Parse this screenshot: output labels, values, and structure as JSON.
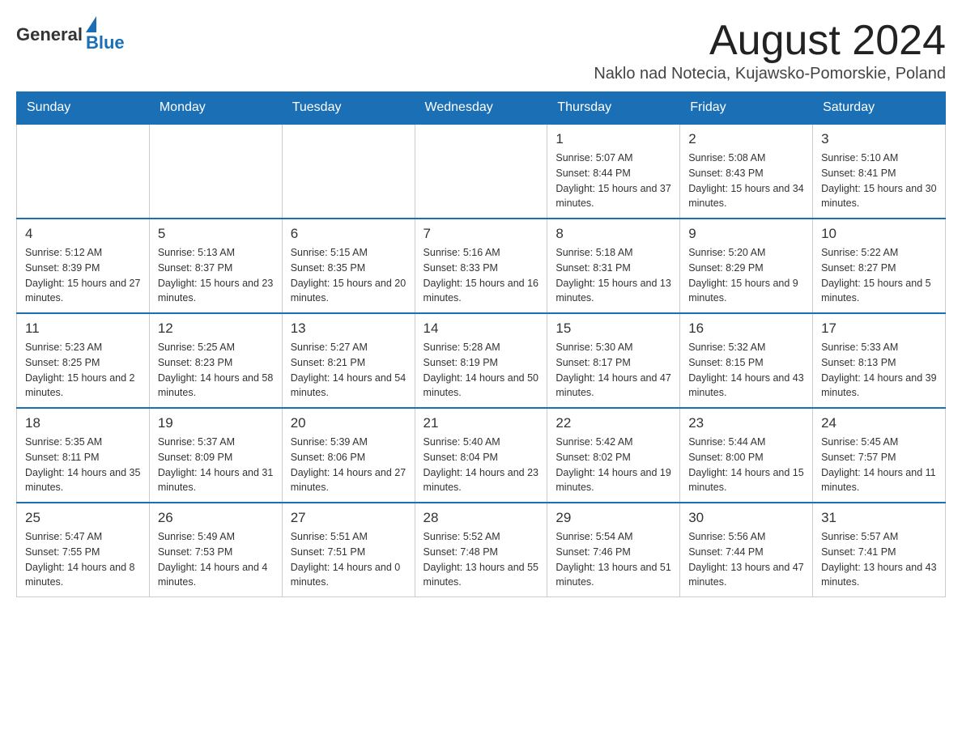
{
  "header": {
    "logo_general": "General",
    "logo_blue": "Blue",
    "title": "August 2024",
    "location": "Naklo nad Notecia, Kujawsko-Pomorskie, Poland"
  },
  "weekdays": [
    "Sunday",
    "Monday",
    "Tuesday",
    "Wednesday",
    "Thursday",
    "Friday",
    "Saturday"
  ],
  "weeks": [
    [
      {
        "day": "",
        "info": ""
      },
      {
        "day": "",
        "info": ""
      },
      {
        "day": "",
        "info": ""
      },
      {
        "day": "",
        "info": ""
      },
      {
        "day": "1",
        "info": "Sunrise: 5:07 AM\nSunset: 8:44 PM\nDaylight: 15 hours and 37 minutes."
      },
      {
        "day": "2",
        "info": "Sunrise: 5:08 AM\nSunset: 8:43 PM\nDaylight: 15 hours and 34 minutes."
      },
      {
        "day": "3",
        "info": "Sunrise: 5:10 AM\nSunset: 8:41 PM\nDaylight: 15 hours and 30 minutes."
      }
    ],
    [
      {
        "day": "4",
        "info": "Sunrise: 5:12 AM\nSunset: 8:39 PM\nDaylight: 15 hours and 27 minutes."
      },
      {
        "day": "5",
        "info": "Sunrise: 5:13 AM\nSunset: 8:37 PM\nDaylight: 15 hours and 23 minutes."
      },
      {
        "day": "6",
        "info": "Sunrise: 5:15 AM\nSunset: 8:35 PM\nDaylight: 15 hours and 20 minutes."
      },
      {
        "day": "7",
        "info": "Sunrise: 5:16 AM\nSunset: 8:33 PM\nDaylight: 15 hours and 16 minutes."
      },
      {
        "day": "8",
        "info": "Sunrise: 5:18 AM\nSunset: 8:31 PM\nDaylight: 15 hours and 13 minutes."
      },
      {
        "day": "9",
        "info": "Sunrise: 5:20 AM\nSunset: 8:29 PM\nDaylight: 15 hours and 9 minutes."
      },
      {
        "day": "10",
        "info": "Sunrise: 5:22 AM\nSunset: 8:27 PM\nDaylight: 15 hours and 5 minutes."
      }
    ],
    [
      {
        "day": "11",
        "info": "Sunrise: 5:23 AM\nSunset: 8:25 PM\nDaylight: 15 hours and 2 minutes."
      },
      {
        "day": "12",
        "info": "Sunrise: 5:25 AM\nSunset: 8:23 PM\nDaylight: 14 hours and 58 minutes."
      },
      {
        "day": "13",
        "info": "Sunrise: 5:27 AM\nSunset: 8:21 PM\nDaylight: 14 hours and 54 minutes."
      },
      {
        "day": "14",
        "info": "Sunrise: 5:28 AM\nSunset: 8:19 PM\nDaylight: 14 hours and 50 minutes."
      },
      {
        "day": "15",
        "info": "Sunrise: 5:30 AM\nSunset: 8:17 PM\nDaylight: 14 hours and 47 minutes."
      },
      {
        "day": "16",
        "info": "Sunrise: 5:32 AM\nSunset: 8:15 PM\nDaylight: 14 hours and 43 minutes."
      },
      {
        "day": "17",
        "info": "Sunrise: 5:33 AM\nSunset: 8:13 PM\nDaylight: 14 hours and 39 minutes."
      }
    ],
    [
      {
        "day": "18",
        "info": "Sunrise: 5:35 AM\nSunset: 8:11 PM\nDaylight: 14 hours and 35 minutes."
      },
      {
        "day": "19",
        "info": "Sunrise: 5:37 AM\nSunset: 8:09 PM\nDaylight: 14 hours and 31 minutes."
      },
      {
        "day": "20",
        "info": "Sunrise: 5:39 AM\nSunset: 8:06 PM\nDaylight: 14 hours and 27 minutes."
      },
      {
        "day": "21",
        "info": "Sunrise: 5:40 AM\nSunset: 8:04 PM\nDaylight: 14 hours and 23 minutes."
      },
      {
        "day": "22",
        "info": "Sunrise: 5:42 AM\nSunset: 8:02 PM\nDaylight: 14 hours and 19 minutes."
      },
      {
        "day": "23",
        "info": "Sunrise: 5:44 AM\nSunset: 8:00 PM\nDaylight: 14 hours and 15 minutes."
      },
      {
        "day": "24",
        "info": "Sunrise: 5:45 AM\nSunset: 7:57 PM\nDaylight: 14 hours and 11 minutes."
      }
    ],
    [
      {
        "day": "25",
        "info": "Sunrise: 5:47 AM\nSunset: 7:55 PM\nDaylight: 14 hours and 8 minutes."
      },
      {
        "day": "26",
        "info": "Sunrise: 5:49 AM\nSunset: 7:53 PM\nDaylight: 14 hours and 4 minutes."
      },
      {
        "day": "27",
        "info": "Sunrise: 5:51 AM\nSunset: 7:51 PM\nDaylight: 14 hours and 0 minutes."
      },
      {
        "day": "28",
        "info": "Sunrise: 5:52 AM\nSunset: 7:48 PM\nDaylight: 13 hours and 55 minutes."
      },
      {
        "day": "29",
        "info": "Sunrise: 5:54 AM\nSunset: 7:46 PM\nDaylight: 13 hours and 51 minutes."
      },
      {
        "day": "30",
        "info": "Sunrise: 5:56 AM\nSunset: 7:44 PM\nDaylight: 13 hours and 47 minutes."
      },
      {
        "day": "31",
        "info": "Sunrise: 5:57 AM\nSunset: 7:41 PM\nDaylight: 13 hours and 43 minutes."
      }
    ]
  ]
}
